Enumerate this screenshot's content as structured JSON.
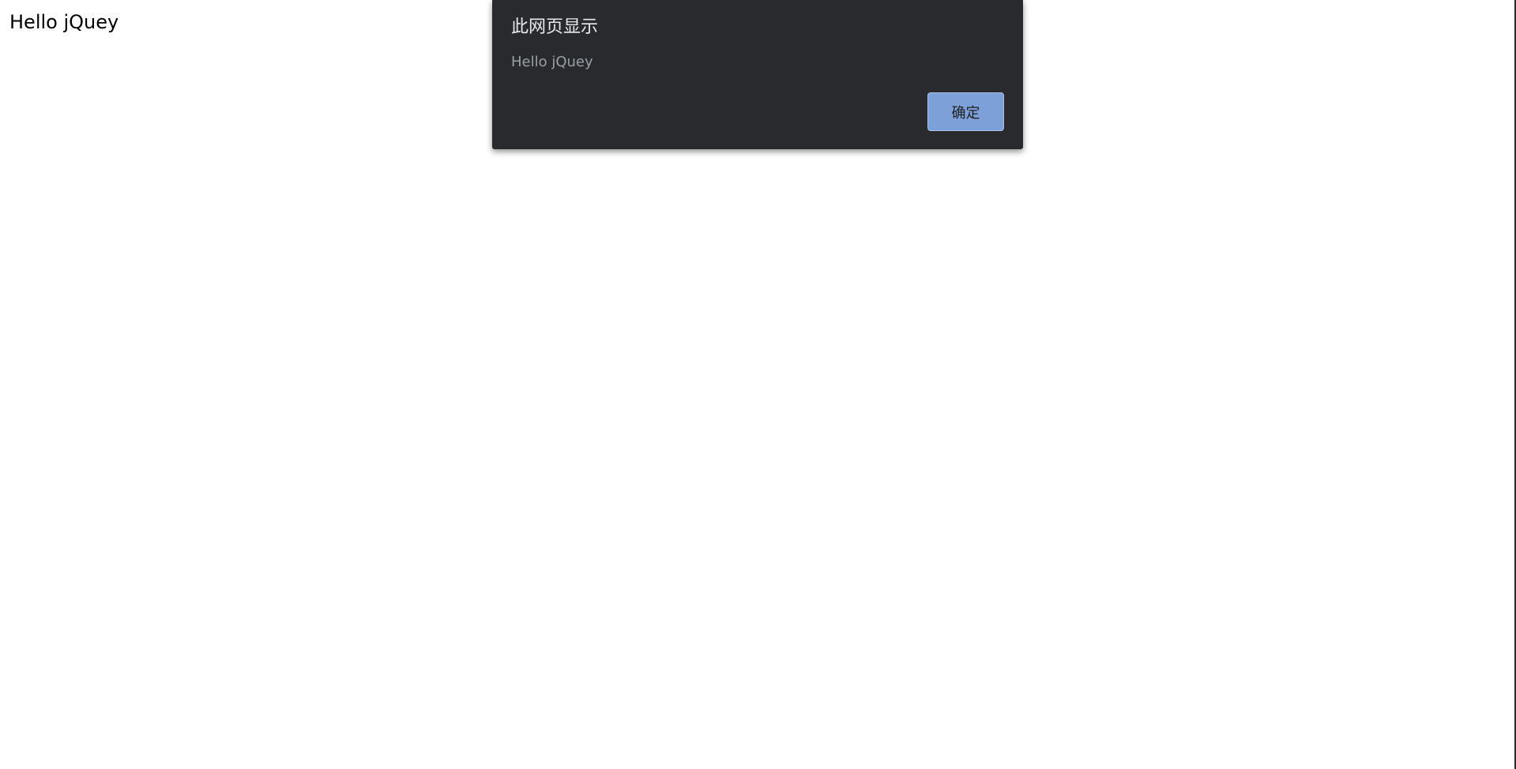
{
  "page": {
    "text": "Hello jQuey"
  },
  "alert": {
    "title": "此网页显示",
    "message": "Hello jQuey",
    "ok_label": "确定"
  },
  "colors": {
    "dialog_background": "#292a2d",
    "button_background": "#7ea0d8",
    "page_background": "#ffffff"
  }
}
